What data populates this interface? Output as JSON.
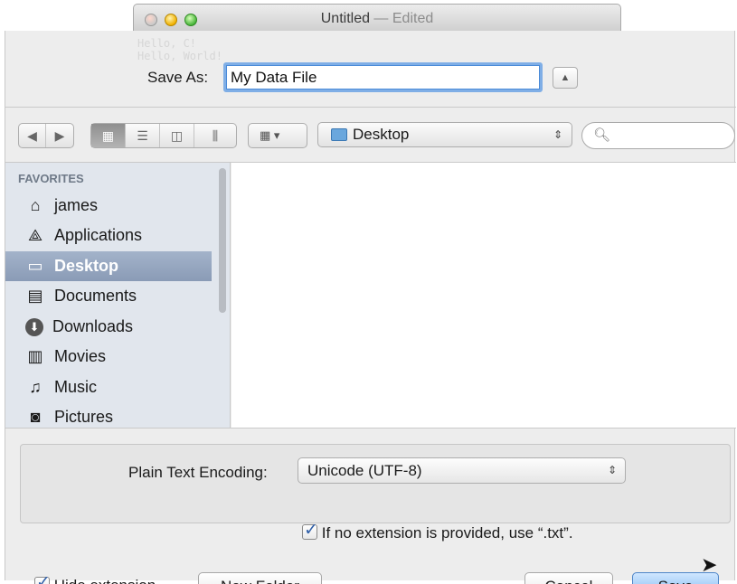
{
  "window": {
    "title": "Untitled",
    "title_separator": " — ",
    "title_status": "Edited",
    "background_text": [
      "Hello, C!",
      "Hello, World!"
    ]
  },
  "save": {
    "label": "Save As:",
    "filename": "My Data File"
  },
  "toolbar": {
    "back_icon": "chevron-left-icon",
    "forward_icon": "chevron-right-icon",
    "views": [
      "icon-view",
      "list-view",
      "column-view",
      "coverflow-view"
    ],
    "active_view": "icon-view",
    "arrange_icon": "arrange-grid-icon",
    "location": "Desktop",
    "search_placeholder": ""
  },
  "sidebar": {
    "heading": "FAVORITES",
    "items": [
      {
        "label": "james",
        "icon": "home-icon"
      },
      {
        "label": "Applications",
        "icon": "applications-icon"
      },
      {
        "label": "Desktop",
        "icon": "desktop-icon",
        "selected": true
      },
      {
        "label": "Documents",
        "icon": "documents-icon"
      },
      {
        "label": "Downloads",
        "icon": "downloads-icon"
      },
      {
        "label": "Movies",
        "icon": "movies-icon"
      },
      {
        "label": "Music",
        "icon": "music-icon"
      },
      {
        "label": "Pictures",
        "icon": "pictures-icon"
      }
    ]
  },
  "options": {
    "encoding_label": "Plain Text Encoding:",
    "encoding_value": "Unicode (UTF-8)",
    "extension_label": "If no extension is provided, use “.txt”.",
    "extension_checked": true
  },
  "footer": {
    "hide_extension_label": "Hide extension",
    "hide_extension_checked": true,
    "new_folder": "New Folder",
    "cancel": "Cancel",
    "save": "Save"
  },
  "colors": {
    "sidebar_bg": "#e1e6ed",
    "selection": "#8a9bb6",
    "focus_ring": "#7faee6",
    "default_button": "#7db7ef"
  }
}
